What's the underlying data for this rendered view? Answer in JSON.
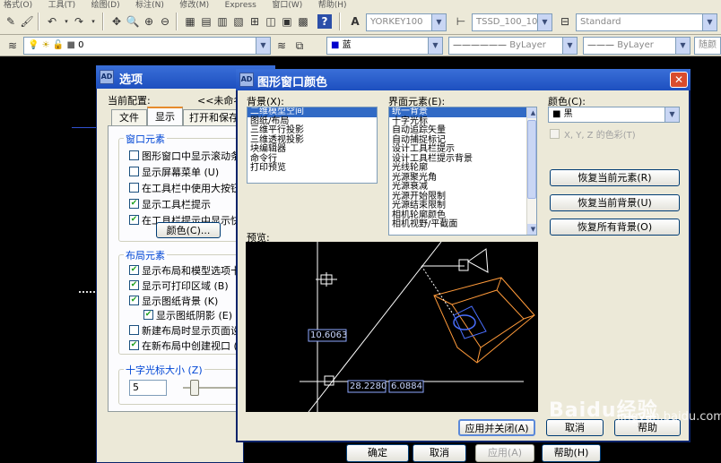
{
  "menubar": [
    "格式(O)",
    "工具(T)",
    "绘图(D)",
    "标注(N)",
    "修改(M)",
    "Express",
    "窗口(W)",
    "帮助(H)"
  ],
  "toolbar": {
    "text_style": "YORKEY100",
    "dim_style": "TSSD_100_100",
    "table_style": "Standard",
    "layer": "0",
    "color": "蓝",
    "linetype": "ByLayer",
    "lineweight": "ByLayer",
    "plot_style": "随颜"
  },
  "options_dialog": {
    "title": "选项",
    "current_profile_label": "当前配置:",
    "current_profile_value": "<<未命名",
    "tabs": [
      "文件",
      "显示",
      "打开和保存"
    ],
    "window_elements": {
      "title": "窗口元素",
      "items": [
        {
          "label": "图形窗口中显示滚动条",
          "checked": false
        },
        {
          "label": "显示屏幕菜单 (U)",
          "checked": false
        },
        {
          "label": "在工具栏中使用大按钮",
          "checked": false
        },
        {
          "label": "显示工具栏提示",
          "checked": true
        },
        {
          "label": "在工具栏提示中显示快",
          "checked": true
        }
      ],
      "color_button": "颜色(C)..."
    },
    "layout_elements": {
      "title": "布局元素",
      "items": [
        {
          "label": "显示布局和模型选项卡",
          "checked": true
        },
        {
          "label": "显示可打印区域 (B)",
          "checked": true
        },
        {
          "label": "显示图纸背景 (K)",
          "checked": true
        },
        {
          "label": "显示图纸阴影 (E)",
          "checked": true
        },
        {
          "label": "新建布局时显示页面设",
          "checked": false
        },
        {
          "label": "在新布局中创建视口 (",
          "checked": true
        }
      ]
    },
    "crosshair": {
      "title": "十字光标大小 (Z)",
      "value": "5"
    },
    "buttons": {
      "ok": "确定",
      "cancel": "取消",
      "apply": "应用(A)",
      "help": "帮助(H)"
    }
  },
  "color_dialog": {
    "title": "图形窗口颜色",
    "background_label": "背景(X):",
    "background_items": [
      "二维模型空间",
      "图纸/布局",
      "三维平行投影",
      "三维透视投影",
      "块编辑器",
      "命令行",
      "打印预览"
    ],
    "background_selected": 0,
    "interface_label": "界面元素(E):",
    "interface_items": [
      "统一背景",
      "十字光标",
      "自动追踪矢量",
      "自动捕捉标记",
      "设计工具栏提示",
      "设计工具栏提示背景",
      "光线轮廓",
      "光源聚光角",
      "光源衰减",
      "光源开始限制",
      "光源结束限制",
      "相机轮廓颜色",
      "相机视野/平截面"
    ],
    "interface_selected": 0,
    "color_label": "颜色(C):",
    "color_value": "黑",
    "xyz_tint": "X, Y, Z 的色彩(T)",
    "restore_current_element": "恢复当前元素(R)",
    "restore_current_context": "恢复当前背景(U)",
    "restore_all": "恢复所有背景(O)",
    "preview_label": "预览:",
    "preview_readouts": [
      "10.6063",
      "28.2280",
      "6.0884"
    ],
    "apply_close": "应用并关闭(A)",
    "cancel": "取消",
    "help": "帮助"
  },
  "watermark": {
    "text": "Baidu经验",
    "sub": "jingyan.baidu.com"
  },
  "colors": {
    "titlebar": "#1d4fbf",
    "dialog": "#ece9d8",
    "selection": "#316ac5",
    "preview_bg": "#000000"
  }
}
